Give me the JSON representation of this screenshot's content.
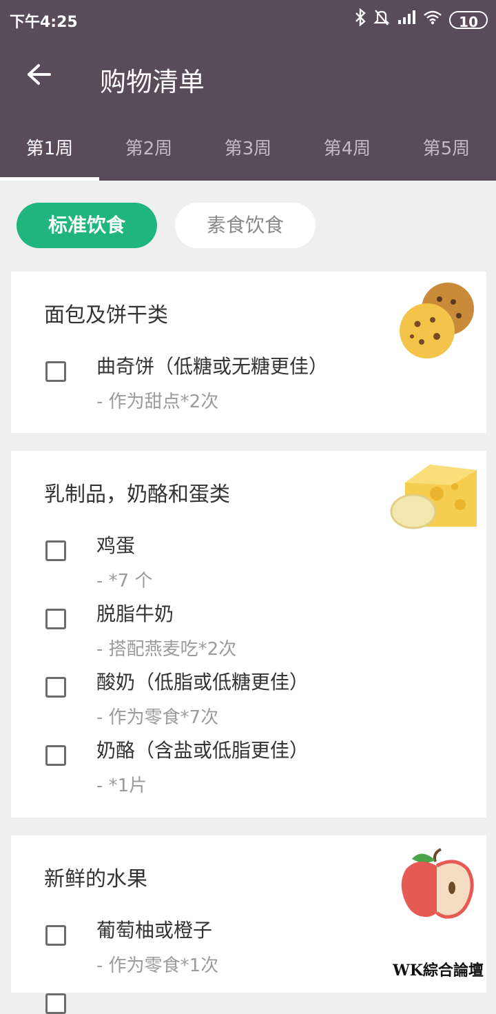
{
  "status": {
    "time": "下午4:25",
    "battery": "10"
  },
  "header": {
    "title": "购物清单"
  },
  "tabs": [
    {
      "label": "第1周",
      "active": true
    },
    {
      "label": "第2周"
    },
    {
      "label": "第3周"
    },
    {
      "label": "第4周"
    },
    {
      "label": "第5周"
    }
  ],
  "diet_filter": {
    "standard": "标准饮食",
    "vegetarian": "素食饮食",
    "selected": "standard"
  },
  "sections": [
    {
      "title": "面包及饼干类",
      "image_icon": "cookies-icon",
      "items": [
        {
          "name": "曲奇饼（低糖或无糖更佳）",
          "note": "- 作为甜点*2次",
          "checked": false
        }
      ]
    },
    {
      "title": "乳制品，奶酪和蛋类",
      "image_icon": "cheese-icon",
      "items": [
        {
          "name": "鸡蛋",
          "note": "- *7 个",
          "checked": false
        },
        {
          "name": "脱脂牛奶",
          "note": "- 搭配燕麦吃*2次",
          "checked": false
        },
        {
          "name": "酸奶（低脂或低糖更佳）",
          "note": "- 作为零食*7次",
          "checked": false
        },
        {
          "name": "奶酪（含盐或低脂更佳）",
          "note": "- *1片",
          "checked": false
        }
      ]
    },
    {
      "title": "新鲜的水果",
      "image_icon": "apple-icon",
      "items": [
        {
          "name": "葡萄柚或橙子",
          "note": "- 作为零食*1次",
          "checked": false
        }
      ]
    }
  ],
  "watermark": "WK綜合論壇",
  "colors": {
    "header": "#5a4b58",
    "accent": "#20b57e",
    "background": "#efefef"
  }
}
